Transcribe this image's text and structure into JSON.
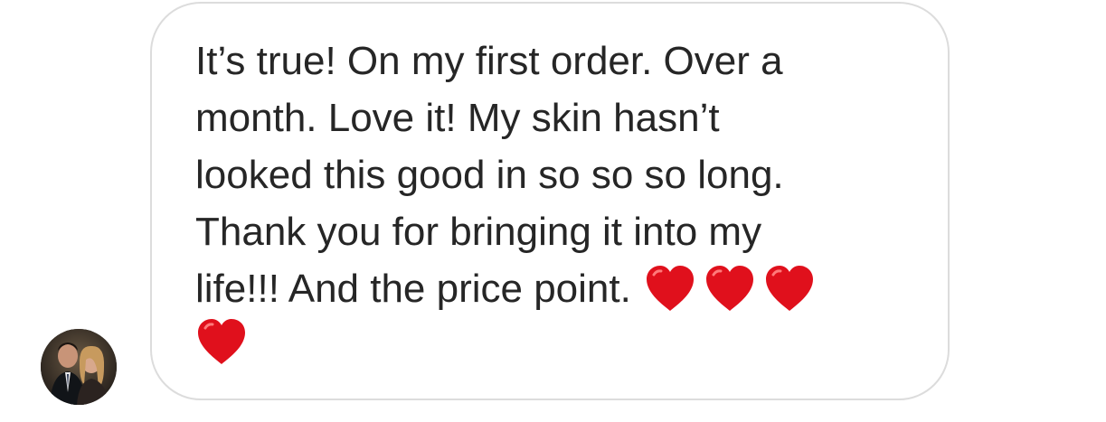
{
  "conversation": {
    "avatar": {
      "description_icon": "avatar-photo"
    },
    "message": {
      "lines": [
        "It’s true!  On my first order. Over a",
        "month. Love it!  My skin hasn’t",
        "looked this good in so so so long.",
        "Thank you for bringing it into my",
        "life!!!   And the price point."
      ],
      "emoji": "❤️",
      "heart_count_inline": 3,
      "heart_count_next_line": 1
    },
    "colors": {
      "bubble_border": "#dcdcdc",
      "text": "#262626",
      "heart": "#e0101c"
    }
  }
}
